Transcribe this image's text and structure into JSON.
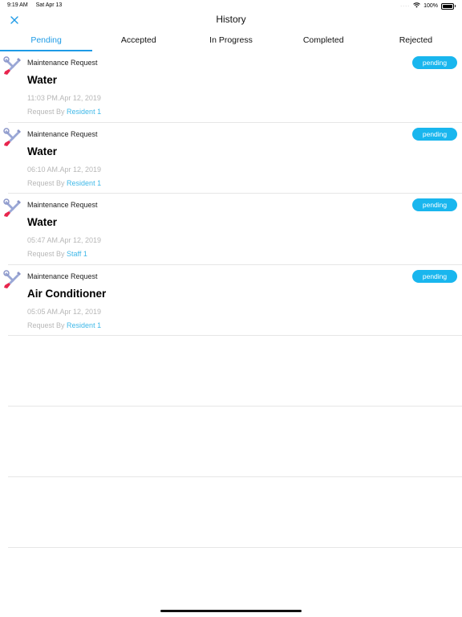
{
  "status_bar": {
    "time": "9:19 AM",
    "date": "Sat Apr 13",
    "battery": "100%"
  },
  "nav": {
    "title": "History"
  },
  "tabs": [
    {
      "label": "Pending"
    },
    {
      "label": "Accepted"
    },
    {
      "label": "In Progress"
    },
    {
      "label": "Completed"
    },
    {
      "label": "Rejected"
    }
  ],
  "requests": [
    {
      "type": "Maintenance Request",
      "title": "Water",
      "time": "11:03 PM.Apr 12, 2019",
      "request_by_label": "Request By",
      "requester": "Resident 1",
      "status": "pending"
    },
    {
      "type": "Maintenance Request",
      "title": "Water",
      "time": "06:10 AM.Apr 12, 2019",
      "request_by_label": "Request By",
      "requester": "Resident 1",
      "status": "pending"
    },
    {
      "type": "Maintenance Request",
      "title": "Water",
      "time": "05:47 AM.Apr 12, 2019",
      "request_by_label": "Request By",
      "requester": "Staff 1",
      "status": "pending"
    },
    {
      "type": "Maintenance Request",
      "title": "Air Conditioner",
      "time": "05:05 AM.Apr 12, 2019",
      "request_by_label": "Request By",
      "requester": "Resident 1",
      "status": "pending"
    }
  ],
  "colors": {
    "accent": "#1e9be6",
    "badge": "#19b6ee",
    "requester": "#3fb8e8",
    "muted": "#b7b7b7"
  }
}
